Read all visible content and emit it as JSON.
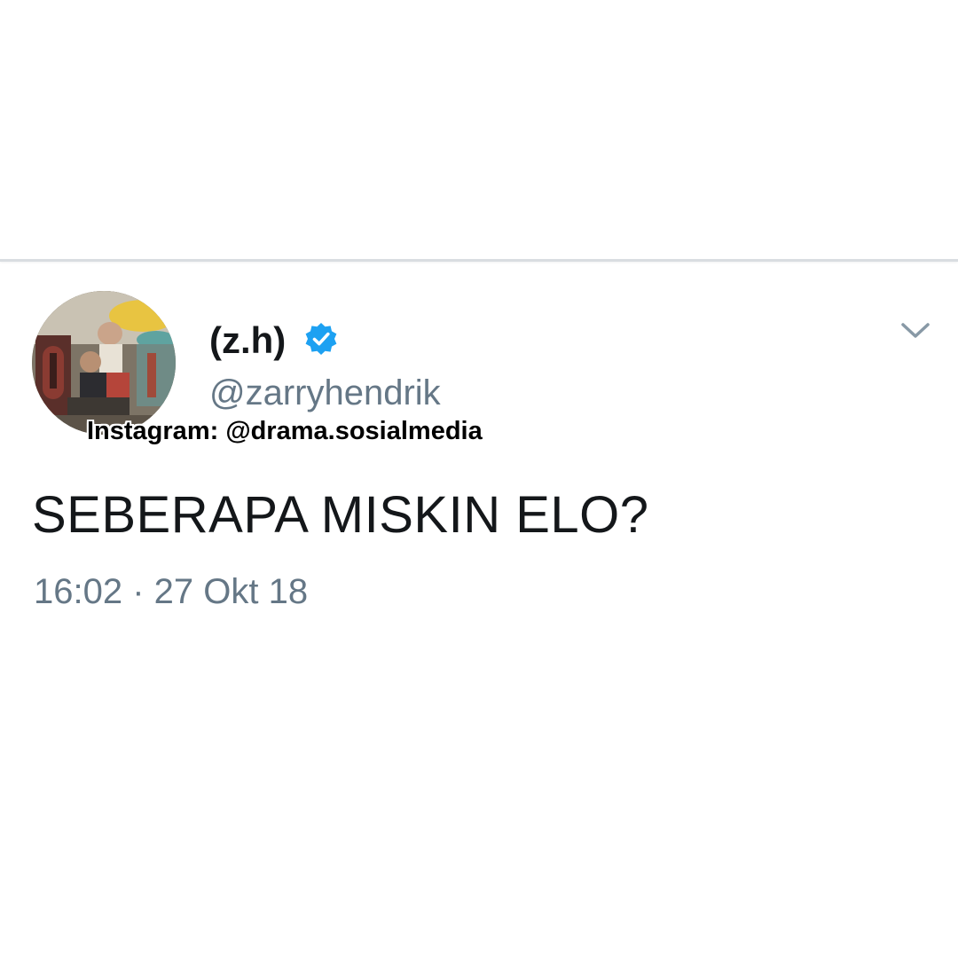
{
  "tweet": {
    "author": {
      "display_name": "(z.h)",
      "handle": "@zarryhendrik",
      "verified": true,
      "verified_icon": "verified-badge-icon",
      "avatar_icon": "profile-photo"
    },
    "text": "SEBERAPA MISKIN ELO?",
    "timestamp": "16:02 · 27 Okt 18",
    "menu_icon": "chevron-down-icon"
  },
  "overlay": {
    "watermark": "Instagram: @drama.sosialmedia"
  },
  "colors": {
    "primary_text": "#14171a",
    "secondary_text": "#657786",
    "verified_blue": "#1da1f2",
    "background": "#ffffff"
  }
}
